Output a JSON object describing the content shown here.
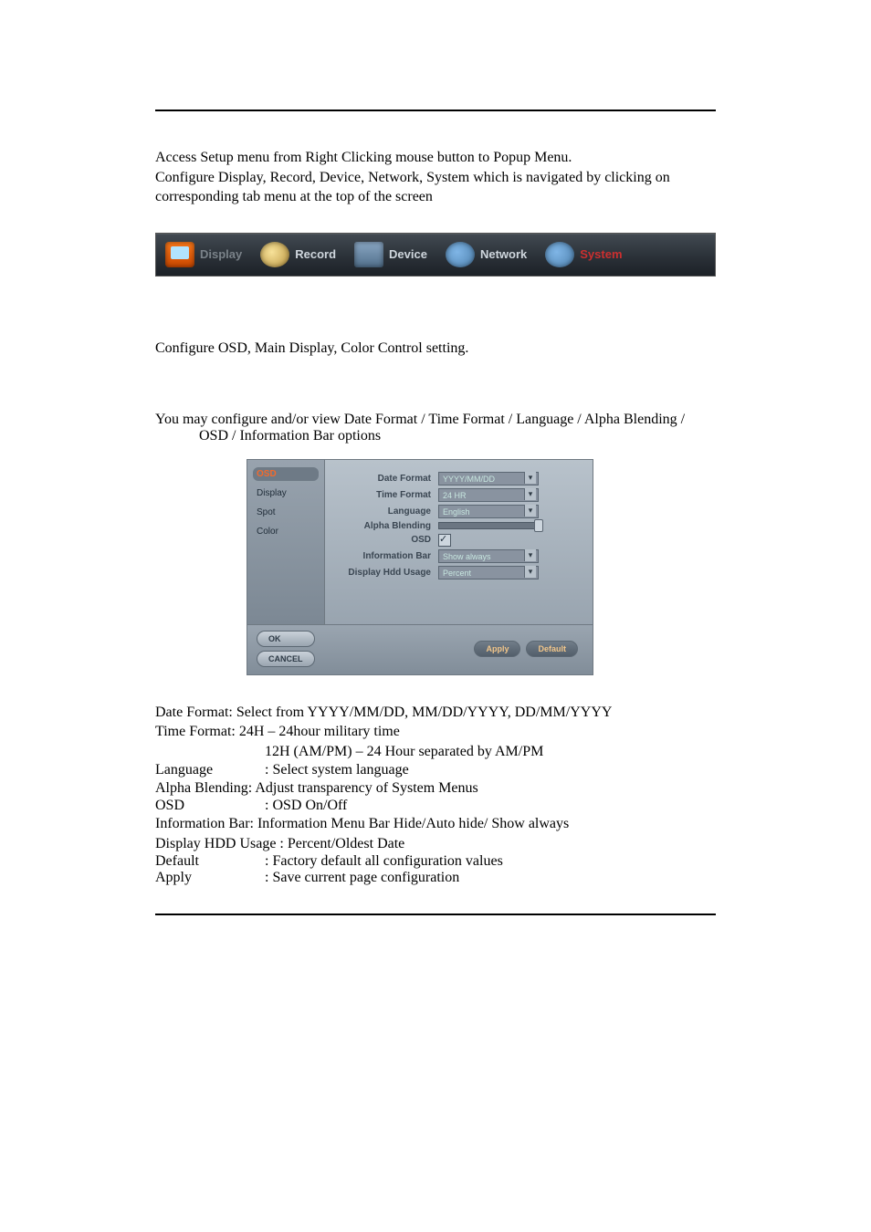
{
  "intro": {
    "line1": "Access Setup menu from Right Clicking mouse button to Popup Menu.",
    "line2": "Configure Display, Record, Device, Network, System which is navigated by clicking on corresponding tab menu at the top of the screen"
  },
  "tabs": {
    "display": "Display",
    "record": "Record",
    "device": "Device",
    "network": "Network",
    "system": "System"
  },
  "section1": "Configure OSD, Main Display, Color Control setting.",
  "section2": "You may configure and/or view Date Format / Time Format / Language / Alpha Blending / OSD / Information Bar options",
  "osd": {
    "side": {
      "osd": "OSD",
      "display": "Display",
      "spot": "Spot",
      "color": "Color"
    },
    "labels": {
      "date_format": "Date Format",
      "time_format": "Time Format",
      "language": "Language",
      "alpha_blending": "Alpha Blending",
      "osd": "OSD",
      "information_bar": "Information Bar",
      "display_hdd_usage": "Display Hdd Usage"
    },
    "values": {
      "date_format": "YYYY/MM/DD",
      "time_format": "24 HR",
      "language": "English",
      "information_bar": "Show always",
      "display_hdd_usage": "Percent"
    },
    "buttons": {
      "ok": "OK",
      "cancel": "CANCEL",
      "apply": "Apply",
      "default": "Default"
    }
  },
  "defs": {
    "date_format": "Date Format: Select from YYYY/MM/DD, MM/DD/YYYY, DD/MM/YYYY",
    "time_format_a": "Time Format: 24H – 24hour military time",
    "time_format_b": "12H (AM/PM) – 24 Hour separated by AM/PM",
    "language_k": "Language",
    "language_v": ": Select system language",
    "alpha": "Alpha Blending: Adjust transparency of System Menus",
    "osd_k": "OSD",
    "osd_v": ": OSD On/Off",
    "info_bar": "Information Bar: Information Menu Bar Hide/Auto hide/ Show always",
    "hdd": "Display HDD Usage : Percent/Oldest Date",
    "default_k": "Default",
    "default_v": ": Factory default all configuration values",
    "apply_k": "Apply",
    "apply_v": ": Save current page configuration"
  }
}
